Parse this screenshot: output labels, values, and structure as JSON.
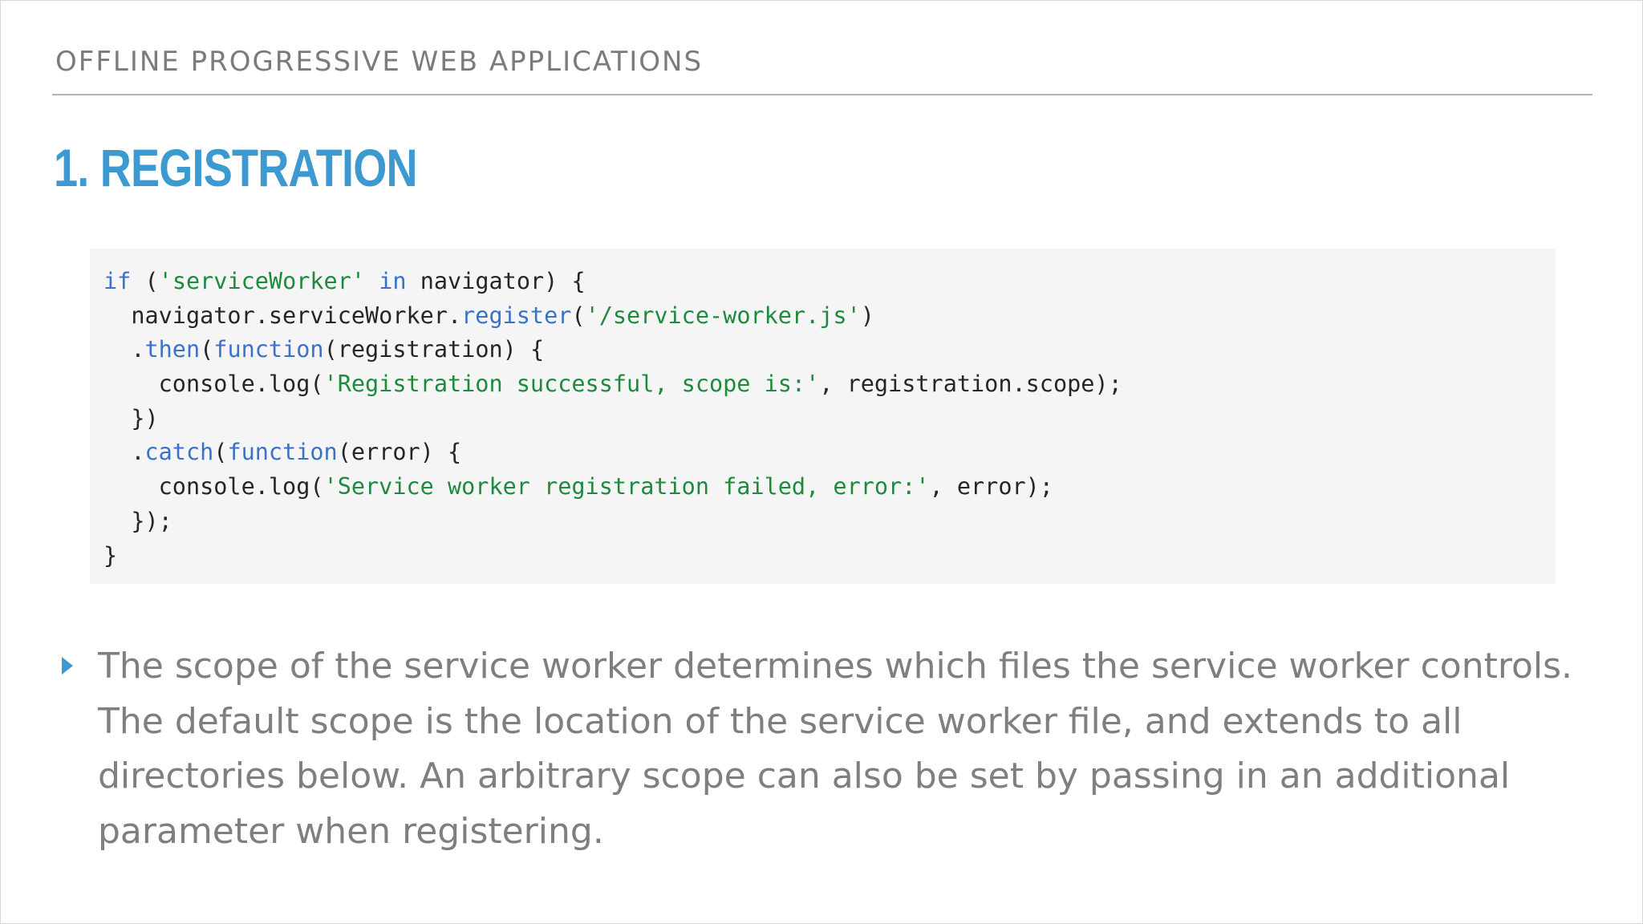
{
  "header": {
    "label": "OFFLINE PROGRESSIVE WEB APPLICATIONS"
  },
  "title": "1. REGISTRATION",
  "code": {
    "lines": [
      [
        {
          "t": "if",
          "c": "kw"
        },
        {
          "t": " (",
          "c": "pl"
        },
        {
          "t": "'serviceWorker'",
          "c": "str"
        },
        {
          "t": " ",
          "c": "pl"
        },
        {
          "t": "in",
          "c": "kw"
        },
        {
          "t": " navigator) {",
          "c": "pl"
        }
      ],
      [
        {
          "t": "  navigator.serviceWorker.",
          "c": "pl"
        },
        {
          "t": "register",
          "c": "kw"
        },
        {
          "t": "(",
          "c": "pl"
        },
        {
          "t": "'/service-worker.js'",
          "c": "str"
        },
        {
          "t": ")",
          "c": "pl"
        }
      ],
      [
        {
          "t": "  .",
          "c": "pl"
        },
        {
          "t": "then",
          "c": "kw"
        },
        {
          "t": "(",
          "c": "pl"
        },
        {
          "t": "function",
          "c": "kw"
        },
        {
          "t": "(registration) {",
          "c": "pl"
        }
      ],
      [
        {
          "t": "    console.log(",
          "c": "pl"
        },
        {
          "t": "'Registration successful, scope is:'",
          "c": "str"
        },
        {
          "t": ", registration.scope);",
          "c": "pl"
        }
      ],
      [
        {
          "t": "  })",
          "c": "pl"
        }
      ],
      [
        {
          "t": "  .",
          "c": "pl"
        },
        {
          "t": "catch",
          "c": "kw"
        },
        {
          "t": "(",
          "c": "pl"
        },
        {
          "t": "function",
          "c": "kw"
        },
        {
          "t": "(error) {",
          "c": "pl"
        }
      ],
      [
        {
          "t": "    console.log(",
          "c": "pl"
        },
        {
          "t": "'Service worker registration failed, error:'",
          "c": "str"
        },
        {
          "t": ", error);",
          "c": "pl"
        }
      ],
      [
        {
          "t": "  });",
          "c": "pl"
        }
      ],
      [
        {
          "t": "}",
          "c": "pl"
        }
      ]
    ]
  },
  "bullet": {
    "text": "The scope of the service worker determines which files the service worker controls.  The default scope is the location of the service worker file, and extends to all directories below. An arbitrary scope can also be set by passing in an additional parameter when registering."
  },
  "colors": {
    "accent": "#3d9ad1",
    "keyword": "#3a72c8",
    "string": "#1e8a3e",
    "body_text": "#7f7f7f",
    "code_bg": "#f5f5f5"
  }
}
